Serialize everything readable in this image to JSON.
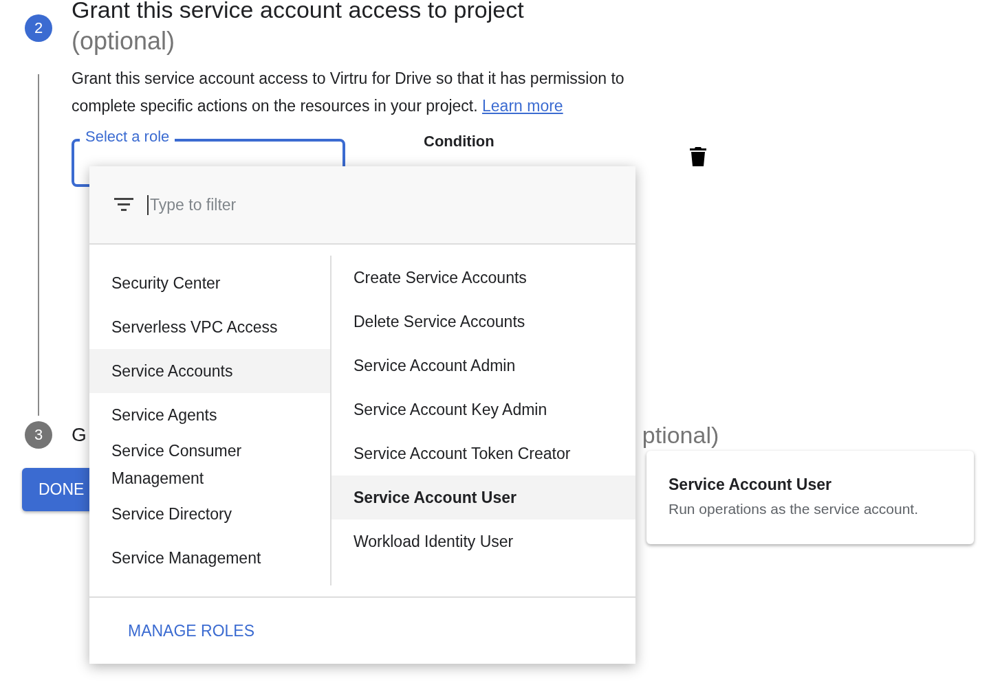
{
  "steps": [
    {
      "number": "2",
      "active": true,
      "title": "Grant this service account access to project",
      "title_suffix": "(optional)"
    },
    {
      "number": "3",
      "active": false,
      "title_start": "G",
      "title_end": "ptional)"
    }
  ],
  "description": "Grant this service account access to Virtru for Drive so that it has permission to complete specific actions on the resources in your project.",
  "learn_more": "Learn more",
  "role_field": {
    "label": "Select a role",
    "focused": true
  },
  "condition": {
    "label": "Condition"
  },
  "done_button": "DONE",
  "role_menu": {
    "filter_placeholder": "Type to filter",
    "categories": [
      {
        "label": "Security Center",
        "selected": false
      },
      {
        "label": "Serverless VPC Access",
        "selected": false
      },
      {
        "label": "Service Accounts",
        "selected": true
      },
      {
        "label": "Service Agents",
        "selected": false
      },
      {
        "label": "Service Consumer Management",
        "selected": false
      },
      {
        "label": "Service Directory",
        "selected": false
      },
      {
        "label": "Service Management",
        "selected": false
      }
    ],
    "roles": [
      {
        "label": "Create Service Accounts",
        "selected": false
      },
      {
        "label": "Delete Service Accounts",
        "selected": false
      },
      {
        "label": "Service Account Admin",
        "selected": false
      },
      {
        "label": "Service Account Key Admin",
        "selected": false
      },
      {
        "label": "Service Account Token Creator",
        "selected": false
      },
      {
        "label": "Service Account User",
        "selected": true
      },
      {
        "label": "Workload Identity User",
        "selected": false
      }
    ],
    "manage_roles": "MANAGE ROLES"
  },
  "tooltip": {
    "title": "Service Account User",
    "description": "Run operations as the service account."
  }
}
